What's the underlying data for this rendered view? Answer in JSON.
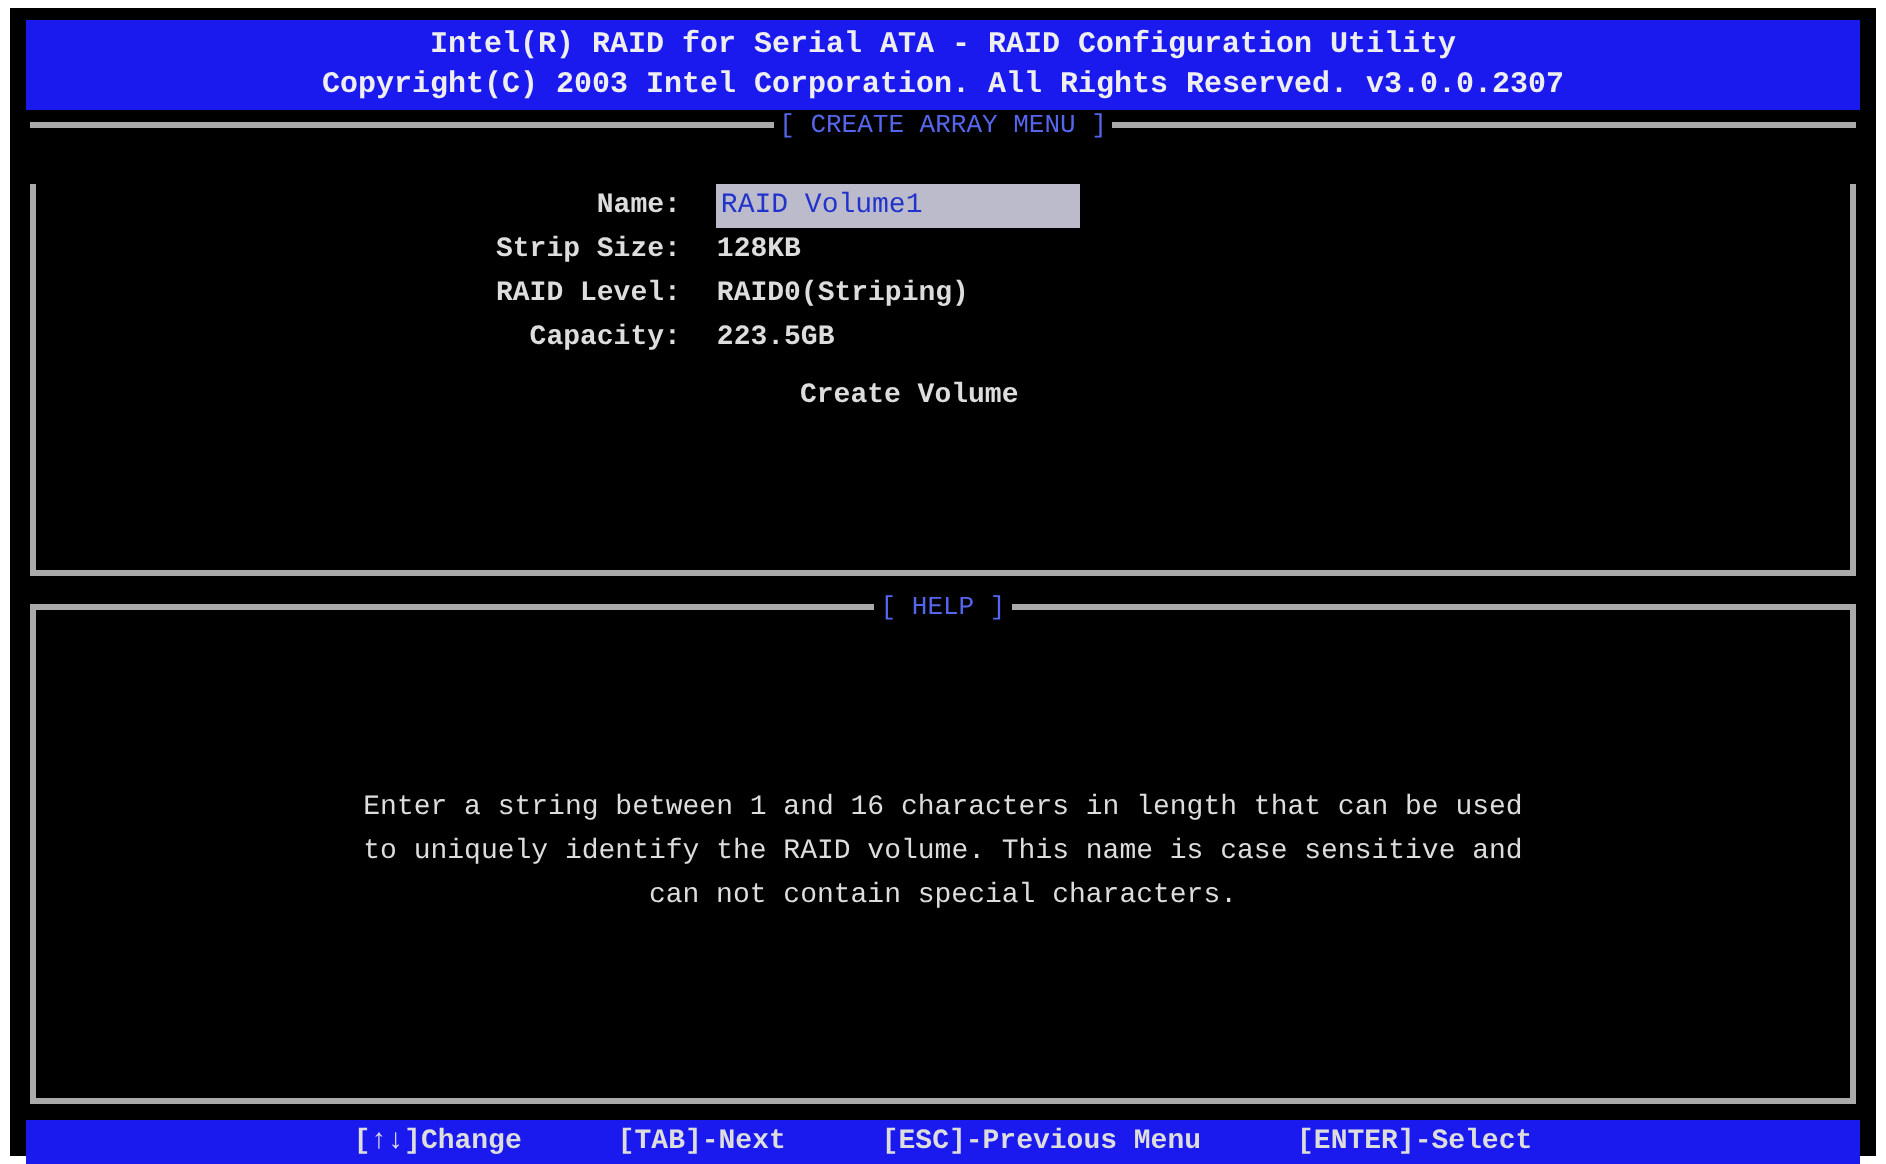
{
  "header": {
    "title": "Intel(R) RAID for Serial ATA - RAID Configuration Utility",
    "copyright": "Copyright(C) 2003 Intel Corporation.  All Rights Reserved. v3.0.0.2307"
  },
  "create_panel": {
    "title": "[ CREATE ARRAY MENU ]",
    "fields": [
      {
        "label": "Name:",
        "value": "RAID Volume1",
        "selected": true
      },
      {
        "label": "Strip Size:",
        "value": "128KB",
        "selected": false
      },
      {
        "label": "RAID Level:",
        "value": "RAID0(Striping)",
        "selected": false
      },
      {
        "label": "Capacity:",
        "value": "223.5GB",
        "selected": false
      }
    ],
    "action": {
      "label": "Create Volume",
      "selected": false
    }
  },
  "help_panel": {
    "title": "[ HELP ]",
    "text": "Enter a string between 1 and 16 characters in length that can be used\nto uniquely identify the RAID volume. This name is case sensitive and\ncan not contain special characters."
  },
  "status_bar": [
    "[↑↓]Change",
    "[TAB]-Next",
    "[ESC]-Previous Menu",
    "[ENTER]-Select"
  ]
}
